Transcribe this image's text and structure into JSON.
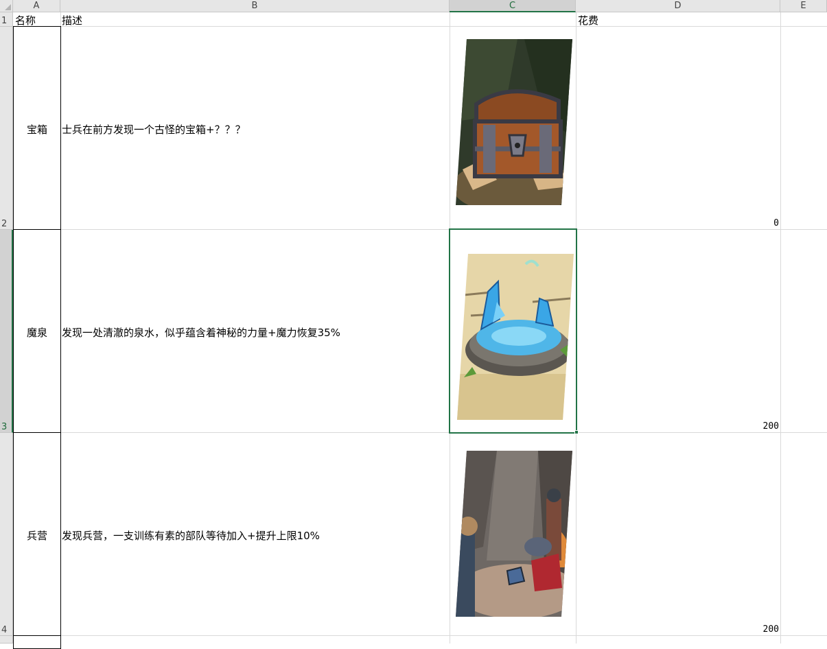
{
  "columns": [
    "A",
    "B",
    "C",
    "D",
    "E"
  ],
  "row_numbers": [
    "1",
    "2",
    "3",
    "4"
  ],
  "header_row": {
    "name": "名称",
    "description": "描述",
    "image": "",
    "cost": "花费"
  },
  "rows": [
    {
      "name": "宝箱",
      "description": "士兵在前方发现一个古怪的宝箱+？？？",
      "image_icon": "treasure-chest-illustration",
      "cost": "0"
    },
    {
      "name": "魔泉",
      "description": "发现一处清澈的泉水，似乎蕴含着神秘的力量+魔力恢复35%",
      "image_icon": "magic-spring-illustration",
      "cost": "200"
    },
    {
      "name": "兵营",
      "description": "发现兵营，一支训练有素的部队等待加入+提升上限10%",
      "image_icon": "barracks-illustration",
      "cost": "200"
    }
  ],
  "colors": {
    "selection": "#217346",
    "header_bg": "#e6e6e6",
    "gridline": "#d9d9d9"
  }
}
